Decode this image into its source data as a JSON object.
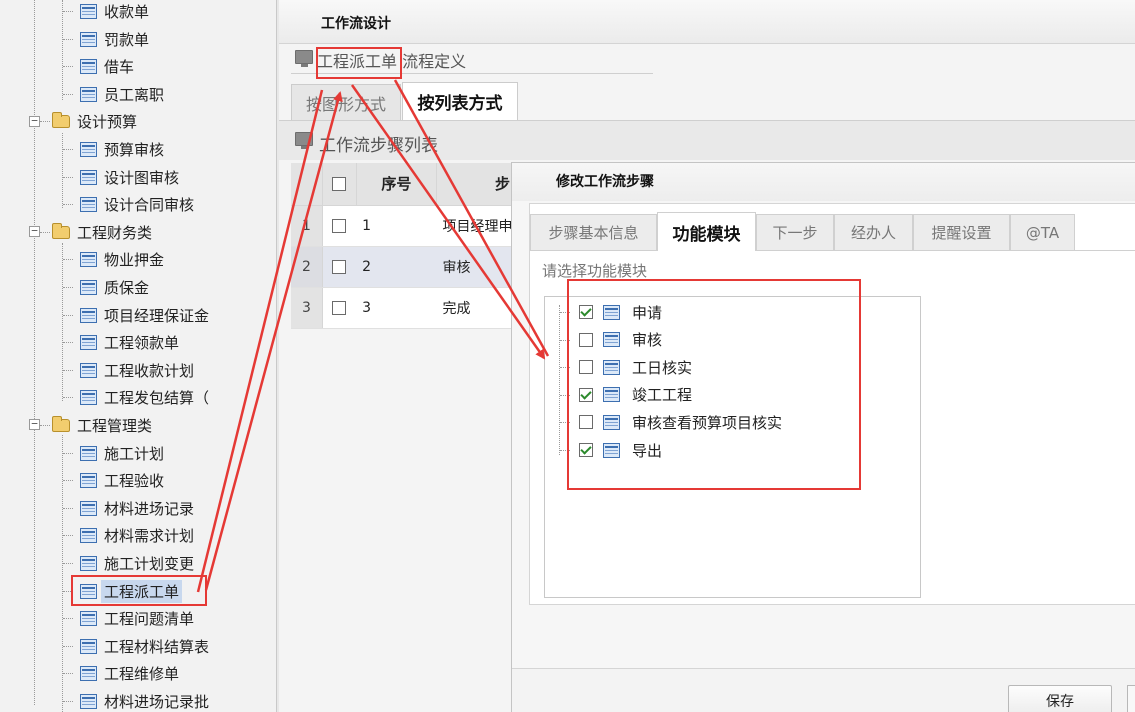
{
  "tree": {
    "items": [
      {
        "label": "收款单",
        "type": "doc",
        "level": 2
      },
      {
        "label": "罚款单",
        "type": "doc",
        "level": 2
      },
      {
        "label": "借车",
        "type": "doc",
        "level": 2
      },
      {
        "label": "员工离职",
        "type": "doc",
        "level": 2
      },
      {
        "label": "设计预算",
        "type": "folder",
        "level": 1
      },
      {
        "label": "预算审核",
        "type": "doc",
        "level": 2
      },
      {
        "label": "设计图审核",
        "type": "doc",
        "level": 2
      },
      {
        "label": "设计合同审核",
        "type": "doc",
        "level": 2
      },
      {
        "label": "工程财务类",
        "type": "folder",
        "level": 1
      },
      {
        "label": "物业押金",
        "type": "doc",
        "level": 2
      },
      {
        "label": "质保金",
        "type": "doc",
        "level": 2
      },
      {
        "label": "项目经理保证金",
        "type": "doc",
        "level": 2
      },
      {
        "label": "工程领款单",
        "type": "doc",
        "level": 2
      },
      {
        "label": "工程收款计划",
        "type": "doc",
        "level": 2
      },
      {
        "label": "工程发包结算（",
        "type": "doc",
        "level": 2
      },
      {
        "label": "工程管理类",
        "type": "folder",
        "level": 1
      },
      {
        "label": "施工计划",
        "type": "doc",
        "level": 2
      },
      {
        "label": "工程验收",
        "type": "doc",
        "level": 2
      },
      {
        "label": "材料进场记录",
        "type": "doc",
        "level": 2
      },
      {
        "label": "材料需求计划",
        "type": "doc",
        "level": 2
      },
      {
        "label": "施工计划变更",
        "type": "doc",
        "level": 2
      },
      {
        "label": "工程派工单",
        "type": "doc",
        "level": 2,
        "selected": true
      },
      {
        "label": "工程问题清单",
        "type": "doc",
        "level": 2
      },
      {
        "label": "工程材料结算表",
        "type": "doc",
        "level": 2
      },
      {
        "label": "工程维修单",
        "type": "doc",
        "level": 2
      },
      {
        "label": "材料进场记录批",
        "type": "doc",
        "level": 2
      }
    ]
  },
  "main": {
    "title": "工作流设计",
    "breadcrumb_current": "工程派工单",
    "breadcrumb_rest": " 流程定义",
    "tabs": [
      "按图形方式",
      "按列表方式"
    ],
    "list_title": "工作流步骤列表",
    "table": {
      "headers": [
        "序号",
        "步"
      ],
      "rows": [
        {
          "num": "1",
          "seq": "1",
          "name": "项目经理申"
        },
        {
          "num": "2",
          "seq": "2",
          "name": "审核"
        },
        {
          "num": "3",
          "seq": "3",
          "name": "完成"
        }
      ]
    }
  },
  "dialog": {
    "title": "修改工作流步骤",
    "tabs": [
      "步骤基本信息",
      "功能模块",
      "下一步",
      "经办人",
      "提醒设置",
      "@TA"
    ],
    "active_tab": "功能模块",
    "select_label": "请选择功能模块",
    "modules": [
      {
        "label": "申请",
        "checked": true
      },
      {
        "label": "审核",
        "checked": false
      },
      {
        "label": "工日核实",
        "checked": false
      },
      {
        "label": "竣工工程",
        "checked": true
      },
      {
        "label": "审核查看预算项目核实",
        "checked": false
      },
      {
        "label": "导出",
        "checked": true
      }
    ],
    "save_label": "保存"
  },
  "colors": {
    "annotation": "#e53935",
    "selected_bg": "#c8d8ee",
    "check": "#2c8a2c"
  }
}
